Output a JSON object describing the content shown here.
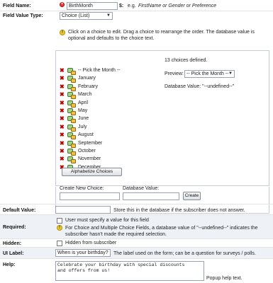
{
  "field_name": {
    "label": "Field Name:",
    "value": "BirthMonth",
    "var_prefix": "$:",
    "hint_prefix": "e.g.",
    "hint": "FirstName or Gender or Preference"
  },
  "field_value_type": {
    "label": "Field Value Type:",
    "selected": "Choice (List)",
    "instructions": "Click on a choice to edit. Drag a choice to rearrange the order. The database value is optional and defaults to the choice text.",
    "choices": [
      "-- Pick the Month --",
      "January",
      "February",
      "March",
      "April",
      "May",
      "June",
      "July",
      "August",
      "September",
      "October",
      "November",
      "December"
    ],
    "count_text": "13 choices defined.",
    "preview_label": "Preview:",
    "preview_selected": "-- Pick the Month --",
    "db_value_text": "Database Value: \"--undefined--\"",
    "alphabetize_label": "Alphabetize Choices",
    "new_choice_label": "Create New Choice:",
    "db_value_label": "Database Value:",
    "create_label": "Create"
  },
  "default_value": {
    "label": "Default Value:",
    "value": "",
    "note": "Store this in the database if the subscriber does not answer."
  },
  "required": {
    "label": "Required:",
    "checkbox_label": "User must specify a value for this field",
    "note": "For Choice and Multiple Choice Fields, a database value of \"--undefined--\" indicates the subscriber hasn't made the required selection."
  },
  "hidden": {
    "label": "Hidden:",
    "checkbox_label": "Hidden from subscriber"
  },
  "ui_label": {
    "label": "UI Label:",
    "value": "When is your birthday?",
    "note": "The label used on the form; can be a question for surveys / polls."
  },
  "help": {
    "label": "Help:",
    "value": "Celebrate your birthday with special discounts\nand offers from us!",
    "note": "Popup help text."
  }
}
